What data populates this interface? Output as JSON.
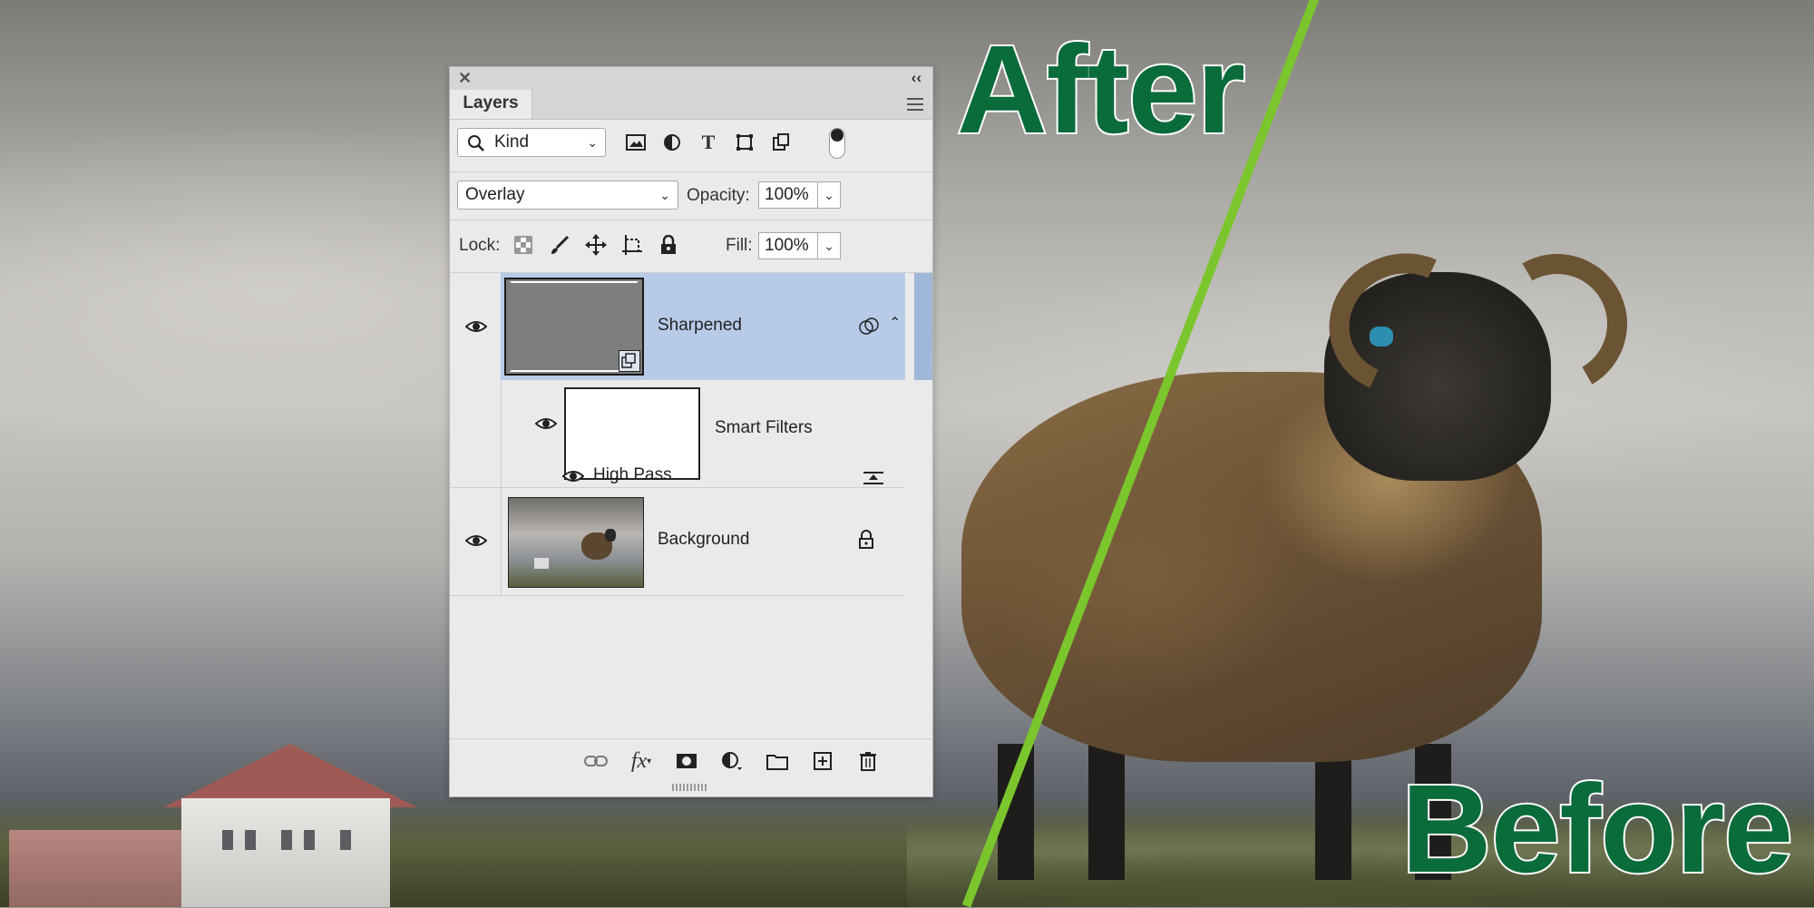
{
  "overlay": {
    "after_label": "After",
    "before_label": "Before",
    "split_color": "#7bc62d",
    "label_color": "#0a6b3b"
  },
  "panel": {
    "close_glyph": "✕",
    "collapse_glyph": "‹‹",
    "tab_label": "Layers",
    "filter": {
      "kind_label": "Kind",
      "icons": [
        "image-filter-icon",
        "adjustment-filter-icon",
        "type-filter-icon",
        "shape-filter-icon",
        "smart-object-filter-icon",
        "filter-toggle-icon"
      ]
    },
    "blend": {
      "mode": "Overlay",
      "opacity_label": "Opacity:",
      "opacity_value": "100%"
    },
    "lock": {
      "label": "Lock:",
      "fill_label": "Fill:",
      "fill_value": "100%",
      "icons": [
        "lock-transparent-icon",
        "lock-paint-icon",
        "lock-position-icon",
        "lock-artboard-icon",
        "lock-all-icon"
      ]
    },
    "layers": [
      {
        "name": "Sharpened",
        "selected": true,
        "type": "smart-object"
      },
      {
        "name": "Smart Filters",
        "type": "smart-filters"
      },
      {
        "name": "High Pass",
        "type": "filter"
      },
      {
        "name": "Background",
        "locked": true,
        "type": "pixel"
      }
    ],
    "footer_icons": [
      "link-icon",
      "fx-icon",
      "mask-icon",
      "adjustment-icon",
      "group-folder-icon",
      "new-layer-icon",
      "trash-icon"
    ],
    "selected_color": "#b7cbe8"
  }
}
